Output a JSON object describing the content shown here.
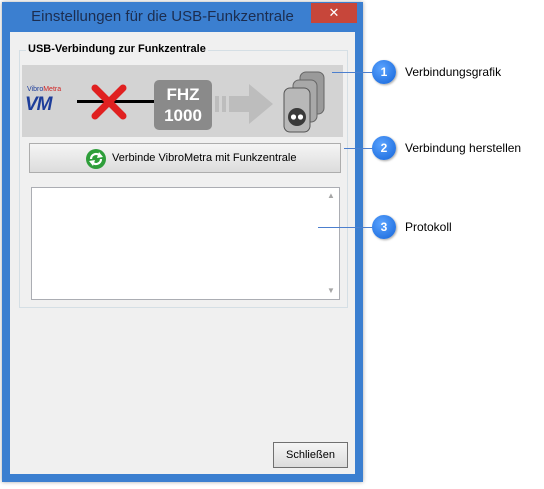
{
  "window": {
    "title": "Einstellungen für die USB-Funkzentrale",
    "close_glyph": "✕"
  },
  "group": {
    "label": "USB-Verbindung zur Funkzentrale"
  },
  "graphic": {
    "logo_top": "Vibro",
    "logo_top_accent": "Metra",
    "logo_main": "VM",
    "device_line1": "FHZ",
    "device_line2": "1000",
    "status": "disconnected"
  },
  "connect_button": {
    "label": "Verbinde VibroMetra mit Funkzentrale",
    "icon": "refresh-icon"
  },
  "log": {
    "content": ""
  },
  "close_button": {
    "label": "Schließen"
  },
  "callouts": [
    {
      "number": "1",
      "label": "Verbindungsgrafik"
    },
    {
      "number": "2",
      "label": "Verbindung herstellen"
    },
    {
      "number": "3",
      "label": "Protokoll"
    }
  ],
  "colors": {
    "titlebar": "#3b7fd0",
    "close": "#c7463a",
    "badge": "#1464d8"
  }
}
